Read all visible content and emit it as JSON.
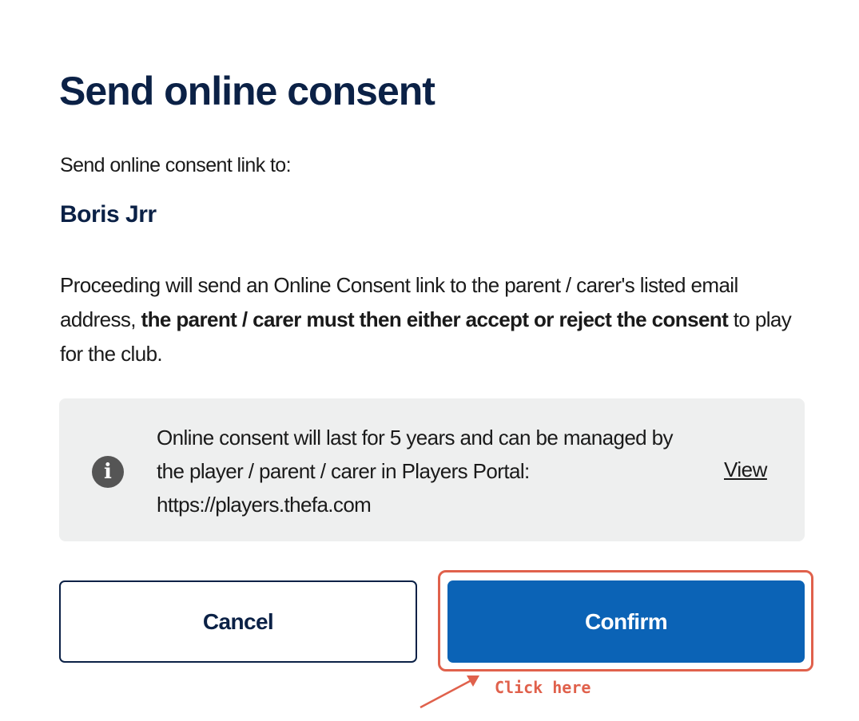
{
  "dialog": {
    "title": "Send online consent",
    "subtitle": "Send online consent link to:",
    "recipient_name": "Boris Jrr",
    "description": {
      "part1": "Proceeding will send an Online Consent link to the parent / carer's listed email address, ",
      "bold": "the parent / carer must then either accept or reject the consent",
      "part2": " to play for the club."
    },
    "info": {
      "icon": "info-icon",
      "icon_glyph": "i",
      "text": "Online consent will last for 5 years and can be managed by the player / parent / carer in Players Portal: https://players.thefa.com",
      "link_label": "View"
    },
    "buttons": {
      "cancel_label": "Cancel",
      "confirm_label": "Confirm"
    }
  },
  "annotation": {
    "text": "Click here",
    "color": "#e0614c"
  },
  "colors": {
    "title": "#0b2146",
    "primary_button": "#0b63b6",
    "info_box_bg": "#eeefef",
    "info_icon_bg": "#555555"
  }
}
